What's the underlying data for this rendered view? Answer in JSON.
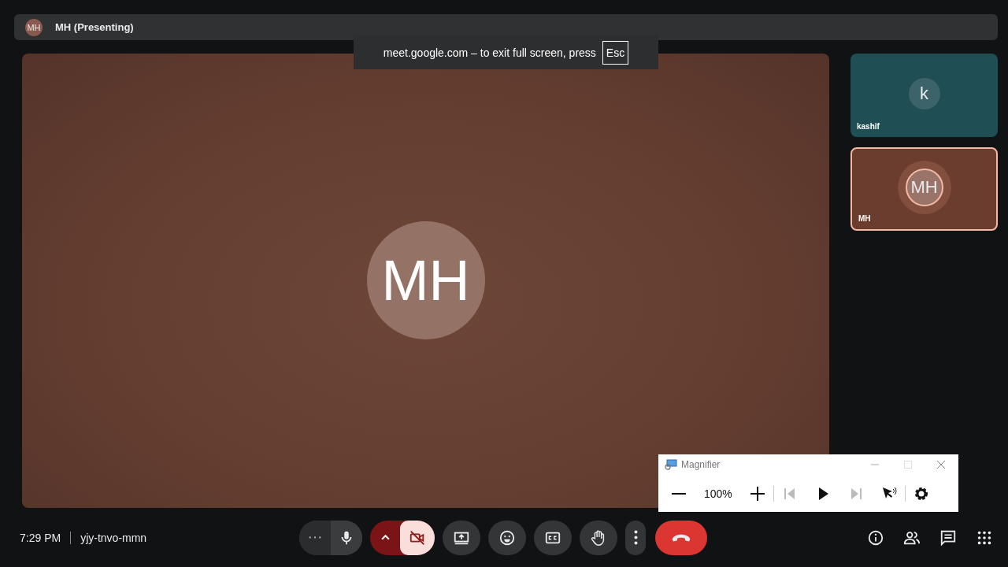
{
  "top_bar": {
    "avatar": "MH",
    "title": "MH (Presenting)"
  },
  "toast": {
    "message": "meet.google.com – to exit full screen, press",
    "key": "Esc"
  },
  "stage": {
    "avatar": "MH"
  },
  "tiles": [
    {
      "name": "kashif",
      "avatar": "k",
      "color": "#1f4e54",
      "speaking": false
    },
    {
      "name": "MH",
      "avatar": "MH",
      "color": "#6b3d2e",
      "speaking": true
    }
  ],
  "magnifier": {
    "title": "Magnifier",
    "zoom": "100%"
  },
  "bottom_bar": {
    "time": "7:29 PM",
    "meeting_code": "yjy-tnvo-mmn",
    "controls": [
      {
        "kind": "mic",
        "off": false
      },
      {
        "kind": "camera",
        "off": true
      },
      {
        "kind": "present"
      },
      {
        "kind": "reactions"
      },
      {
        "kind": "captions"
      },
      {
        "kind": "hand"
      },
      {
        "kind": "more"
      },
      {
        "kind": "leave"
      }
    ],
    "side_buttons": [
      {
        "kind": "info"
      },
      {
        "kind": "people"
      },
      {
        "kind": "chat"
      },
      {
        "kind": "activities"
      }
    ]
  }
}
